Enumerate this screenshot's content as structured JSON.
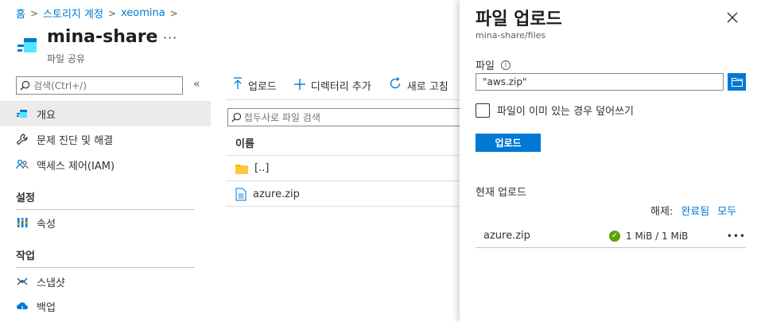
{
  "breadcrumb": {
    "items": [
      "홈",
      "스토리지 계정",
      "xeomina"
    ],
    "separator": ">"
  },
  "resource": {
    "title": "mina-share",
    "subtitle": "파일 공유",
    "more": "···"
  },
  "sidebar": {
    "search_placeholder": "검색(Ctrl+/)",
    "collapse": "«",
    "items": [
      {
        "label": "개요",
        "icon": "file-share-icon"
      },
      {
        "label": "문제 진단 및 해결",
        "icon": "wrench-icon"
      },
      {
        "label": "액세스 제어(IAM)",
        "icon": "people-icon"
      }
    ],
    "sections": [
      {
        "title": "설정",
        "items": [
          {
            "label": "속성",
            "icon": "properties-icon"
          }
        ]
      },
      {
        "title": "작업",
        "items": [
          {
            "label": "스냅샷",
            "icon": "snapshot-icon"
          },
          {
            "label": "백업",
            "icon": "backup-icon"
          }
        ]
      }
    ]
  },
  "toolbar": {
    "upload": "업로드",
    "add_directory": "디렉터리 추가",
    "refresh": "새로 고침"
  },
  "file_list": {
    "search_placeholder": "접두사로 파일 검색",
    "column_name": "이름",
    "rows": [
      {
        "name": "[..]",
        "icon": "folder-icon"
      },
      {
        "name": "azure.zip",
        "icon": "file-icon"
      }
    ]
  },
  "panel": {
    "title": "파일 업로드",
    "path": "mina-share/files",
    "file_label": "파일",
    "file_value": "\"aws.zip\"",
    "overwrite_label": "파일이 이미 있는 경우 덮어쓰기",
    "upload_button": "업로드",
    "current_uploads": "현재 업로드",
    "clear_label": "해제:",
    "clear_completed": "완료됨",
    "clear_all": "모두",
    "uploads": [
      {
        "name": "azure.zip",
        "status": "1 MiB / 1 MiB"
      }
    ],
    "more": "•••"
  },
  "colors": {
    "accent": "#0078d4",
    "success": "#57a300",
    "folder": "#ffb900"
  }
}
